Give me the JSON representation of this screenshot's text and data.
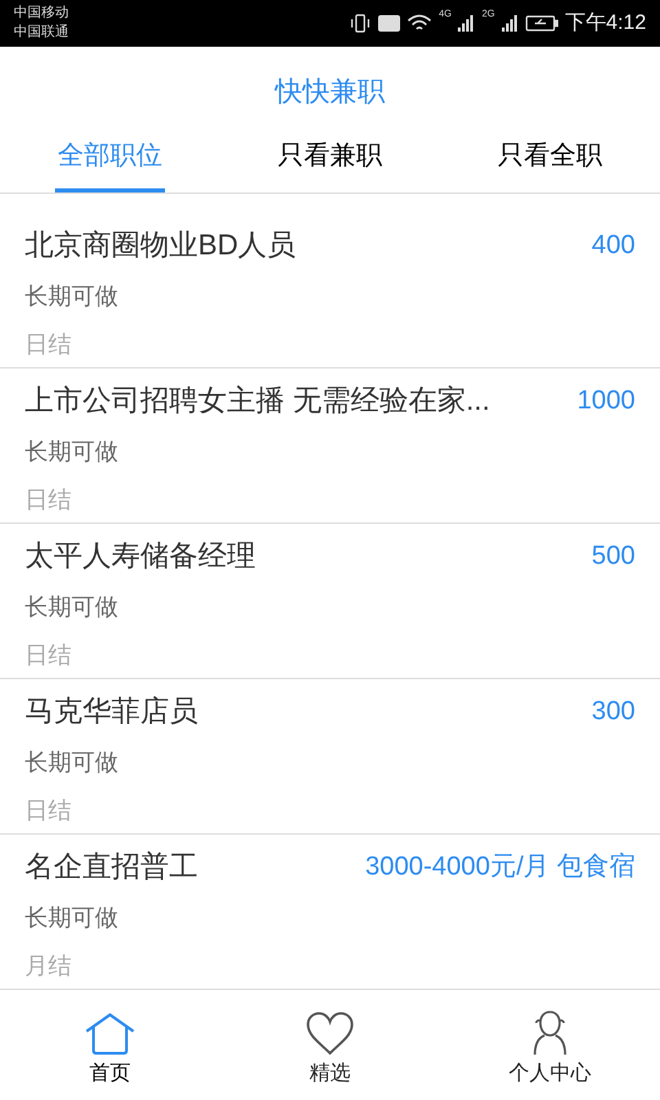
{
  "status_bar": {
    "carriers": [
      "中国移动",
      "中国联通"
    ],
    "network_1": "4G",
    "network_2": "2G",
    "time": "下午4:12"
  },
  "header": {
    "title": "快快兼职"
  },
  "tabs": [
    {
      "label": "全部职位",
      "selected": true
    },
    {
      "label": "只看兼职",
      "selected": false
    },
    {
      "label": "只看全职",
      "selected": false
    }
  ],
  "jobs": [
    {
      "title": "北京商圈物业BD人员",
      "pay": "400",
      "duration": "长期可做",
      "settlement": "日结"
    },
    {
      "title": "上市公司招聘女主播 无需经验在家...",
      "pay": "1000",
      "duration": "长期可做",
      "settlement": "日结"
    },
    {
      "title": "太平人寿储备经理",
      "pay": "500",
      "duration": "长期可做",
      "settlement": "日结"
    },
    {
      "title": "马克华菲店员",
      "pay": "300",
      "duration": "长期可做",
      "settlement": "日结"
    },
    {
      "title": "名企直招普工",
      "pay": "3000-4000元/月 包食宿",
      "duration": "长期可做",
      "settlement": "月结"
    }
  ],
  "nav": [
    {
      "label": "首页",
      "kind": "home",
      "selected": true
    },
    {
      "label": "精选",
      "kind": "heart",
      "selected": false
    },
    {
      "label": "个人中心",
      "kind": "person",
      "selected": false
    }
  ]
}
